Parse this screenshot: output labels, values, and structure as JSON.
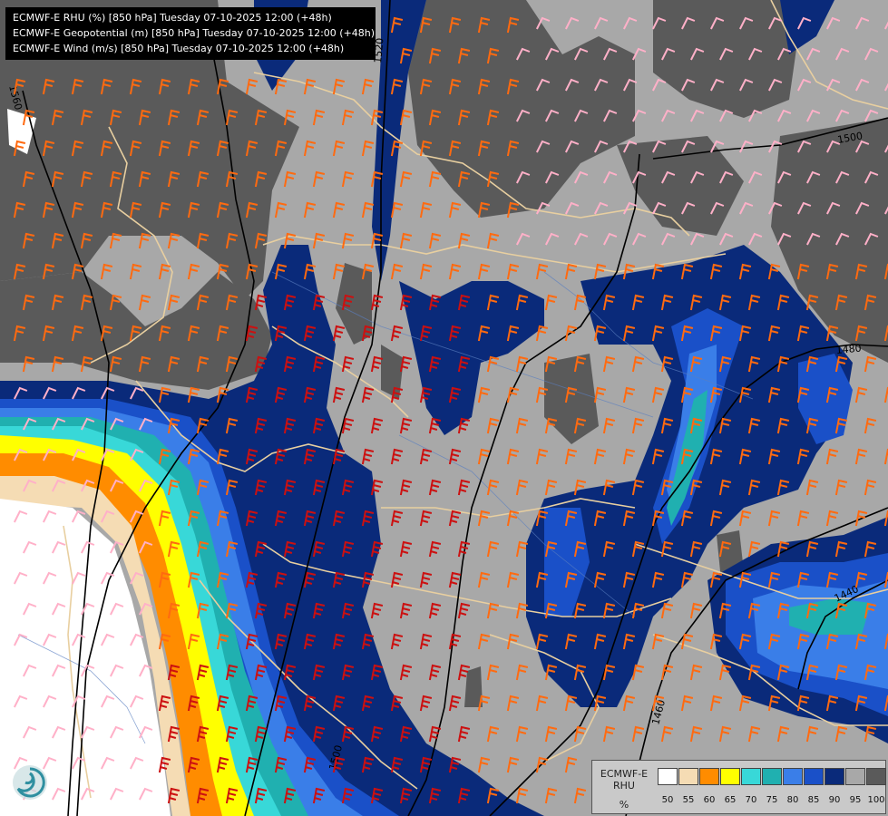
{
  "header": {
    "lines": [
      "ECMWF-E RHU (%) [850 hPa] Tuesday 07-10-2025 12:00 (+48h)",
      "ECMWF-E Geopotential (m) [850 hPa] Tuesday 07-10-2025 12:00 (+48h)",
      "ECMWF-E Wind (m/s) [850 hPa] Tuesday 07-10-2025 12:00 (+48h)"
    ]
  },
  "contour_labels": [
    "1560",
    "1520",
    "1500",
    "1480",
    "1440",
    "1460",
    "1500",
    "1520"
  ],
  "legend": {
    "model": "ECMWF-E",
    "variable": "RHU",
    "unit": "%",
    "colors": [
      "#ffffff",
      "#f5dcb4",
      "#ff8c00",
      "#ffff00",
      "#38d8d8",
      "#20b0b0",
      "#3a7ee8",
      "#1a50c8",
      "#0a2a7a",
      "#a8a8a8",
      "#5a5a5a"
    ],
    "ticks": [
      "50",
      "55",
      "60",
      "65",
      "70",
      "75",
      "80",
      "85",
      "90",
      "95",
      "100"
    ]
  },
  "colors": {
    "rh_95": "#a8a8a8",
    "rh_100": "#5a5a5a",
    "rh_90": "#0a2a7a",
    "rh_85": "#1a50c8",
    "rh_80": "#3a7ee8",
    "wind_weak": "#ffb0c8",
    "wind_mid": "#ff6a10",
    "wind_strong": "#cc1010",
    "border": "#e8cfa0",
    "contour": "#000000",
    "title_bg": "#000000"
  }
}
